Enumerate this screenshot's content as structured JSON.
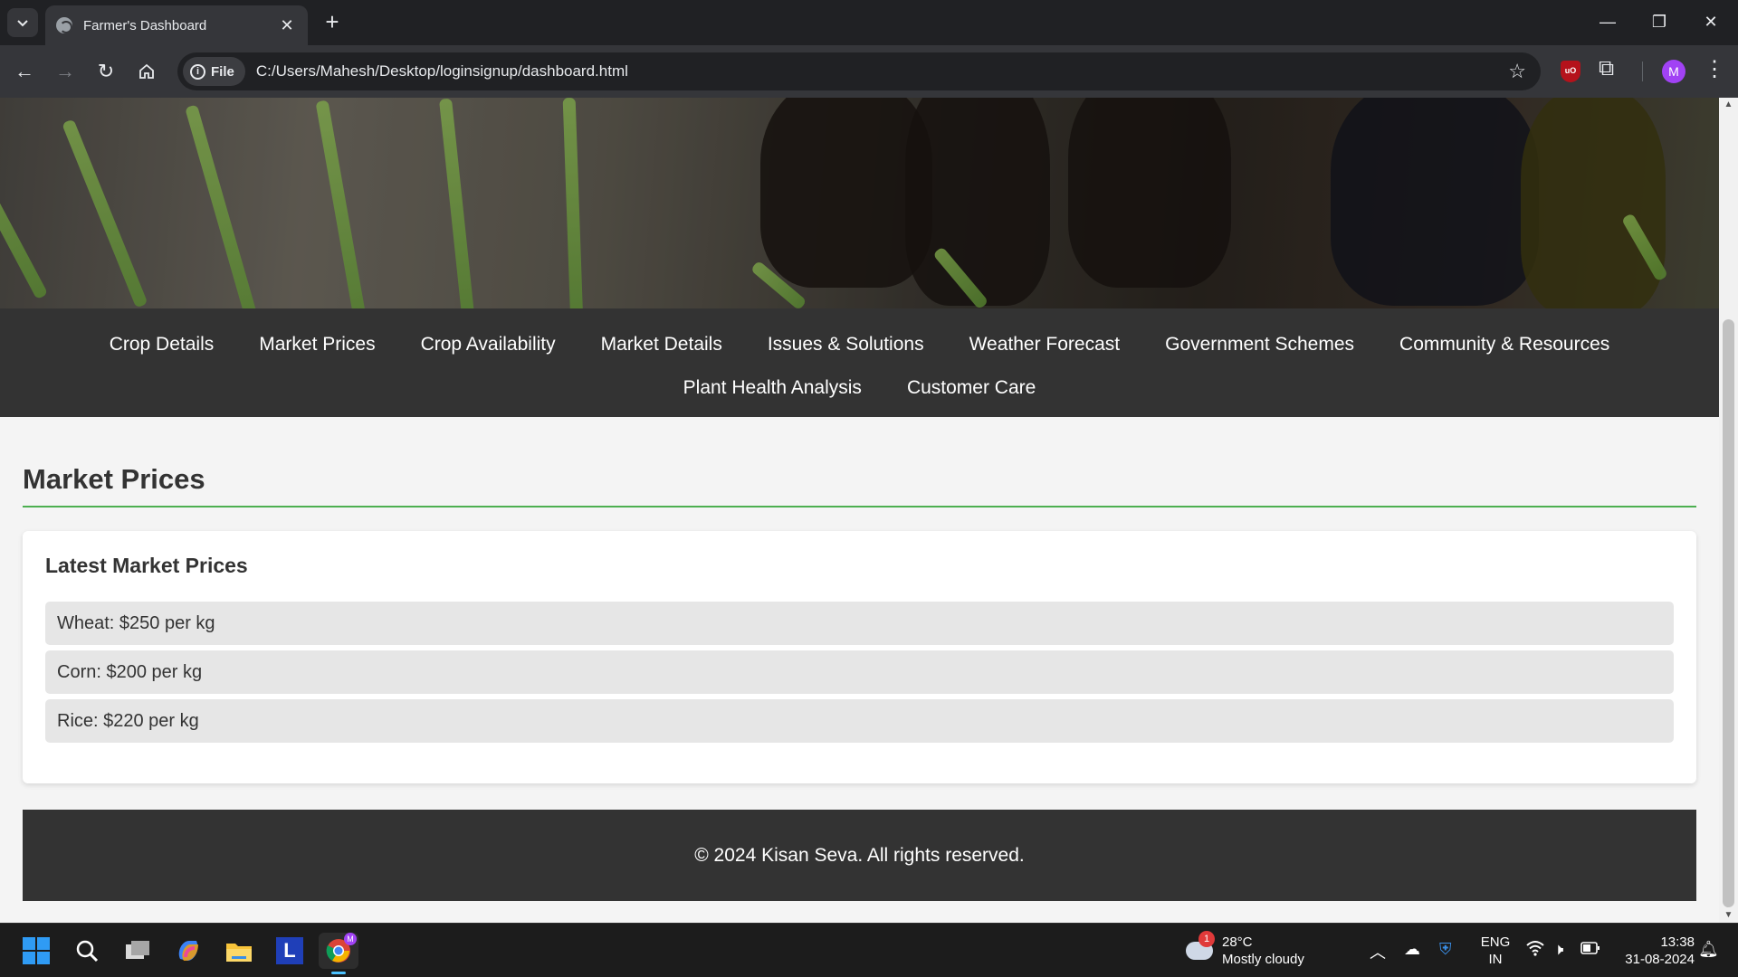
{
  "browser": {
    "tab_title": "Farmer's Dashboard",
    "site_chip": "File",
    "url": "C:/Users/Mahesh/Desktop/loginsignup/dashboard.html",
    "profile_initial": "M",
    "ublock_label": "uO"
  },
  "page": {
    "nav_items": [
      "Crop Details",
      "Market Prices",
      "Crop Availability",
      "Market Details",
      "Issues & Solutions",
      "Weather Forecast",
      "Government Schemes",
      "Community & Resources",
      "Plant Health Analysis",
      "Customer Care"
    ],
    "section_title": "Market Prices",
    "card_title": "Latest Market Prices",
    "prices": [
      "Wheat: $250 per kg",
      "Corn: $200 per kg",
      "Rice: $220 per kg"
    ],
    "footer": "© 2024 Kisan Seva. All rights reserved.",
    "accent_color": "#4caf50"
  },
  "taskbar": {
    "weather_temp": "28°C",
    "weather_desc": "Mostly cloudy",
    "weather_badge": "1",
    "language": "ENG",
    "region": "IN",
    "time": "13:38",
    "date": "31-08-2024",
    "launcher_letter": "L"
  }
}
